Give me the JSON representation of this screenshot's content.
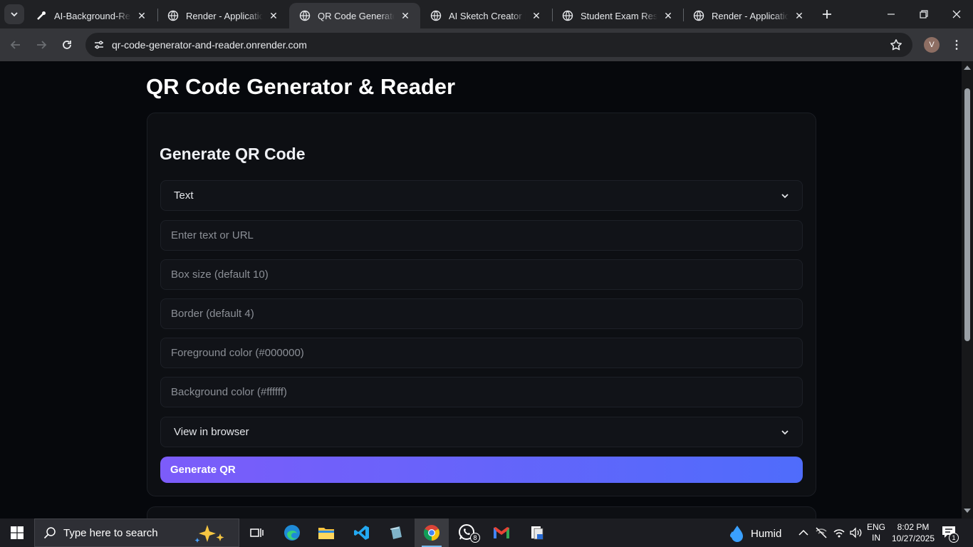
{
  "browser": {
    "tabs": [
      {
        "title": "AI-Background-Remover",
        "favicon": "background-remover-icon",
        "active": false
      },
      {
        "title": "Render - Application Dashboard",
        "favicon": "globe-icon",
        "active": false
      },
      {
        "title": "QR Code Generator & Reader",
        "favicon": "globe-icon",
        "active": true
      },
      {
        "title": "AI Sketch Creator | Vision",
        "favicon": "globe-icon",
        "active": false
      },
      {
        "title": "Student Exam Result",
        "favicon": "globe-icon",
        "active": false
      },
      {
        "title": "Render - Application",
        "favicon": "globe-icon",
        "active": false
      }
    ],
    "url": "qr-code-generator-and-reader.onrender.com",
    "profile_initial": "V"
  },
  "page": {
    "title": "QR Code Generator & Reader",
    "generate_card": {
      "heading": "Generate QR Code",
      "type_select": "Text",
      "text_placeholder": "Enter text or URL",
      "box_size_placeholder": "Box size (default 10)",
      "border_placeholder": "Border (default 4)",
      "fg_placeholder": "Foreground color (#000000)",
      "bg_placeholder": "Background color (#ffffff)",
      "output_select": "View in browser",
      "button_label": "Generate QR"
    }
  },
  "taskbar": {
    "search_placeholder": "Type here to search",
    "weather": "Humid",
    "language_line1": "ENG",
    "language_line2": "IN",
    "time": "8:02 PM",
    "date": "10/27/2025",
    "whatsapp_badge": "8",
    "notification_count": "1"
  },
  "colors": {
    "accent_gradient_start": "#7c5cfa",
    "accent_gradient_end": "#4f6cfb",
    "page_bg": "#06080c"
  }
}
